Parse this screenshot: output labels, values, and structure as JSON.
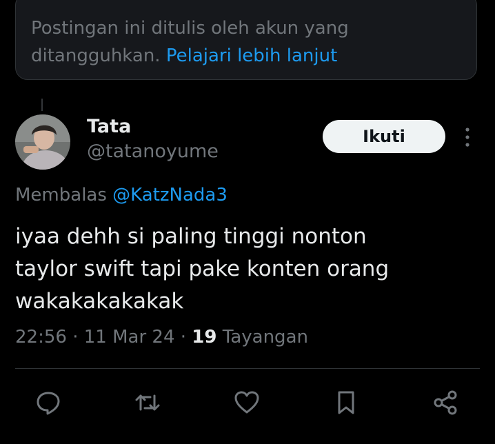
{
  "notice": {
    "text": "Postingan ini ditulis oleh akun yang ditangguhkan.",
    "link": "Pelajari lebih lanjut"
  },
  "author": {
    "display_name": "Tata",
    "handle": "@tatanoyume"
  },
  "follow_label": "Ikuti",
  "reply_to": {
    "prefix": "Membalas",
    "handle": "@KatzNada3"
  },
  "tweet": {
    "line1": "iyaa dehh si paling tinggi nonton",
    "line2": "taylor swift tapi pake konten orang",
    "line3": "wakakakakakak"
  },
  "meta": {
    "time": "22:56",
    "date": "11 Mar 24",
    "views_count": "19",
    "views_label": "Tayangan"
  },
  "actions": [
    "reply-icon",
    "retweet-icon",
    "like-icon",
    "bookmark-icon",
    "share-icon"
  ],
  "colors": {
    "accent": "#1d9bf0",
    "text_primary": "#e7e9ea",
    "text_secondary": "#71767b",
    "background": "#000000"
  }
}
